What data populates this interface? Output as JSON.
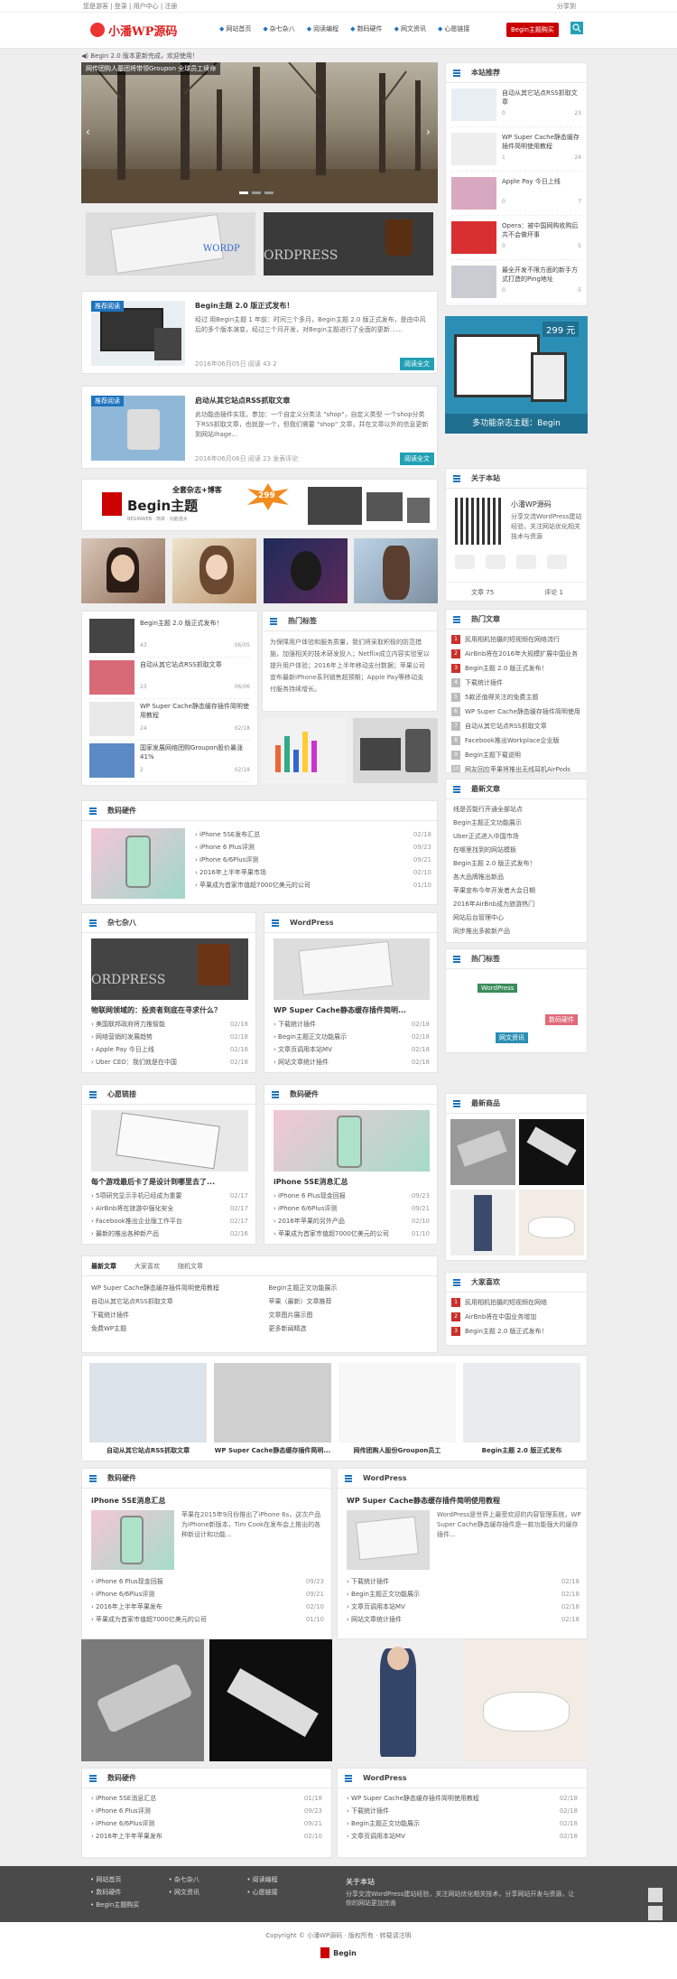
{
  "topbar": {
    "left": "您是游客 | 登录 | 用户中心 | 注册",
    "right": "分享到",
    "logo": "小潘WP源码"
  },
  "nav": [
    "网站首页",
    "杂七杂八",
    "阅读编程",
    "数码硬件",
    "网文资讯",
    "心愿链接"
  ],
  "nav_button": "Begin主题购买",
  "notice": "Begin 2.0 版本更新完成，欢迎使用！",
  "slider": {
    "caption": "网传团购人基团将带领Groupon 全球员工续命"
  },
  "post1": {
    "cat": "推荐阅读",
    "title": "Begin主题 2.0 版正式发布！",
    "excerpt": "经过 用Begin主题 1 年前：时间三个多月，Begin主题 2.0 版正式发布，是由中风后的多个版本演变，经过三个月开发，对Begin主题进行了全面的更新……",
    "meta": "2016年06月05日   阅读 43   2",
    "more": "阅读全文"
  },
  "post2": {
    "cat": "推荐阅读",
    "title": "启动从其它站点RSS抓取文章",
    "excerpt": "此功能由插件实现，参加：一个自定义分类法 \"shop\"，自定义类型 一个shop分类下RSS抓取文章，也就是一个，但我们需要 \"shop\" 文章，并在文章以外的信息更新到网站Ihage...",
    "meta": "2016年06月06日   阅读 23   发表评论",
    "more": "阅读全文"
  },
  "banner": {
    "brand": "Begin主题",
    "tag": "全套杂志+博客",
    "price": "299",
    "sub": "BEGINWEB · 简单 · 功能强大"
  },
  "side_hot": {
    "title": "本站推荐",
    "items": [
      {
        "t": "自动从其它站点RSS抓取文章",
        "a": "0",
        "b": "23"
      },
      {
        "t": "WP Super Cache静态缓存插件简明使用教程",
        "a": "1",
        "b": "24"
      },
      {
        "t": "Apple Pay 今日上线",
        "a": "0",
        "b": "7"
      },
      {
        "t": "Opera：被中国网购收购后共不会做坏事",
        "a": "0",
        "b": "5"
      },
      {
        "t": "最全开发不限方面的新手方式打造的Ping地址",
        "a": "0",
        "b": "5"
      }
    ]
  },
  "ad": {
    "price": "299 元",
    "text": "多功能杂志主题：Begin"
  },
  "about": {
    "title": "关于本站",
    "desc": "小潘WP源码",
    "sub": "分享交流WordPress建站经验，关注网站优化相关技术与资源",
    "stat1": "文章 75",
    "stat2": "评论 1"
  },
  "mini_posts": [
    {
      "t": "Begin主题 2.0 版正式发布！",
      "n": "43",
      "d": "06/05"
    },
    {
      "t": "自动从其它站点RSS抓取文章",
      "n": "23",
      "d": "06/06"
    },
    {
      "t": "WP Super Cache静态缓存插件简明使用教程",
      "n": "24",
      "d": "02/18"
    },
    {
      "t": "国家发展网络团购Groupon股价暴涨41%",
      "n": "2",
      "d": "02/18"
    }
  ],
  "tags_panel": {
    "title": "热门标签",
    "text": "为保障用户体验和服务质量，我们将采取积极的防范措施，加强相关的技术研发投入；Netflix成立内容实验室以提升用户体验；2016年上半年移动支付数据；苹果公司宣布最新iPhone系列销售超预期；Apple Pay等移动支付服务持续增长。"
  },
  "hot_list": {
    "title": "热门文章",
    "items": [
      "民用相机拍摄的短视频在网络流行",
      "AirBnb将在2016年大规模扩展中国业务",
      "Begin主题 2.0 版正式发布！",
      "下载统计插件",
      "5款还值得关注的免费主题",
      "WP Super Cache静态缓存插件简明使用",
      "自动从其它站点RSS抓取文章",
      "Facebook推出Workplace企业版",
      "Begin主题下载说明",
      "网友回应苹果将推出无线耳机AirPods"
    ]
  },
  "recent_cmt": {
    "title": "最新文章",
    "items": [
      "线是否能行开通全部站点",
      "Begin主题正文功能展示",
      "Uber正式进入中国市场",
      "在哪里找到的网站模板",
      "Begin主题 2.0 版正式发布！",
      "各大品牌推出新品",
      "苹果宣布今年开发者大会日期",
      "2016年AirBnb成为旅游热门",
      "网站后台管理中心",
      "同步推出多款新产品"
    ]
  },
  "tag_cloud": {
    "title": "热门标签",
    "tags": [
      "WordPress",
      "网文资讯",
      "数码硬件"
    ]
  },
  "sec_digital": {
    "title": "数码硬件",
    "items": [
      {
        "t": "iPhone 5SE发布汇总",
        "d": "02/18"
      },
      {
        "t": "iPhone 6 Plus评测",
        "d": "09/23"
      },
      {
        "t": "iPhone 6/6Plus评测",
        "d": "09/21"
      },
      {
        "t": "2016年上半年苹果市场",
        "d": "02/10"
      },
      {
        "t": "苹果成为首家市值超7000亿美元的公司",
        "d": "01/10"
      }
    ]
  },
  "sec_misc": {
    "title": "杂七杂八",
    "headline": "物联网领域的：投资者到底在寻求什么？",
    "items": [
      {
        "t": "美国联邦政府将力推智能",
        "d": "02/18"
      },
      {
        "t": "网络营销的发展趋势",
        "d": "02/18"
      },
      {
        "t": "Apple Pay 今日上线",
        "d": "02/18"
      },
      {
        "t": "Uber CEO：我们就是在中国",
        "d": "02/18"
      }
    ]
  },
  "sec_wp": {
    "title": "WordPress",
    "headline": "WP Super Cache静态缓存插件简明...",
    "items": [
      {
        "t": "下载统计插件",
        "d": "02/18"
      },
      {
        "t": "Begin主题正文功能展示",
        "d": "02/18"
      },
      {
        "t": "文章页调用本站MV",
        "d": "02/18"
      },
      {
        "t": "网站文章统计插件",
        "d": "02/18"
      }
    ]
  },
  "sec_heart": {
    "title": "心愿链接",
    "headline": "每个游戏最后卡了是设计到哪里去了...",
    "items": [
      {
        "t": "5项研究显示手机已经成为重要",
        "d": "02/17"
      },
      {
        "t": "AirBnb将在旅游中强化安全",
        "d": "02/17"
      },
      {
        "t": "Facebook推出企业版工作平台",
        "d": "02/17"
      },
      {
        "t": "最新的推出各种新产品",
        "d": "02/16"
      }
    ]
  },
  "sec_digital2": {
    "title": "数码硬件",
    "headline": "iPhone 5SE消息汇总",
    "items": [
      {
        "t": "iPhone 6 Plus现金回报",
        "d": "09/23"
      },
      {
        "t": "iPhone 6/6Plus评测",
        "d": "09/21"
      },
      {
        "t": "2016年苹果的另外产品",
        "d": "02/10"
      },
      {
        "t": "苹果成为首家市值超7000亿美元的公司",
        "d": "01/10"
      }
    ]
  },
  "gallery_title": "最新商品",
  "tabs": [
    "最新文章",
    "大家喜欢",
    "随机文章"
  ],
  "tab_items": [
    "WP Super Cache静态缓存插件简明使用教程",
    "Begin主题正文功能展示",
    "自动从其它站点RSS抓取文章",
    "苹果（最新）文章推荐",
    "下载统计插件",
    "文章图片展示图",
    "免费WP主题",
    "更多新闻精选"
  ],
  "side_recent": {
    "title": "大家喜欢",
    "items": [
      "民用相机拍摄的短视频在网络",
      "AirBnb将在中国业务增加",
      "Begin主题 2.0 版正式发布！"
    ]
  },
  "cards": [
    "自动从其它站点RSS抓取文章",
    "WP Super Cache静态缓存插件简明...",
    "网传团购人股份Groupon员工",
    "Begin主题 2.0 版正式发布"
  ],
  "big_digital": {
    "title": "数码硬件",
    "headline": "iPhone 5SE消息汇总",
    "excerpt": "苹果在2015年9月份推出了iPhone 6s，这次产品为iPhone新版本，Tim Cook在发布会上推出的各种新设计和功能...",
    "items": [
      {
        "t": "iPhone 6 Plus现金回报",
        "d": "09/23"
      },
      {
        "t": "iPhone 6/6Plus评测",
        "d": "09/21"
      },
      {
        "t": "2016年上半年苹果发布",
        "d": "02/10"
      },
      {
        "t": "苹果成为首家市值超7000亿美元的公司",
        "d": "01/10"
      }
    ]
  },
  "big_wp": {
    "title": "WordPress",
    "headline": "WP Super Cache静态缓存插件简明使用教程",
    "excerpt": "WordPress是世界上最受欢迎的内容管理系统，WP Super Cache静态缓存插件是一款功能强大的缓存插件...",
    "items": [
      {
        "t": "下载统计插件",
        "d": "02/18"
      },
      {
        "t": "Begin主题正文功能展示",
        "d": "02/18"
      },
      {
        "t": "文章页调用本站MV",
        "d": "02/18"
      },
      {
        "t": "网站文章统计插件",
        "d": "02/18"
      }
    ]
  },
  "bottom_digital": {
    "title": "数码硬件",
    "items": [
      {
        "t": "iPhone 5SE消息汇总",
        "d": "01/18"
      },
      {
        "t": "iPhone 6 Plus评测",
        "d": "09/23"
      },
      {
        "t": "iPhone 6/6Plus评测",
        "d": "09/21"
      },
      {
        "t": "2016年上半年苹果发布",
        "d": "02/10"
      }
    ]
  },
  "bottom_wp": {
    "title": "WordPress",
    "items": [
      {
        "t": "WP Super Cache静态缓存插件简明使用教程",
        "d": "02/18"
      },
      {
        "t": "下载统计插件",
        "d": "02/18"
      },
      {
        "t": "Begin主题正文功能展示",
        "d": "02/18"
      },
      {
        "t": "文章页调用本站MV",
        "d": "02/18"
      }
    ]
  },
  "footer": {
    "links": [
      "网站首页",
      "杂七杂八",
      "阅读编程",
      "数码硬件",
      "网文资讯",
      "心愿链接",
      "Begin主题购买"
    ],
    "about_title": "关于本站",
    "about_text": "分享交流WordPress建站经验，关注网站优化相关技术，分享网站开发与资源，让你的网站更加完善",
    "copyright": "Copyright © 小潘WP源码 · 版权所有 · 转载请注明",
    "foot_logo": "Begin"
  }
}
